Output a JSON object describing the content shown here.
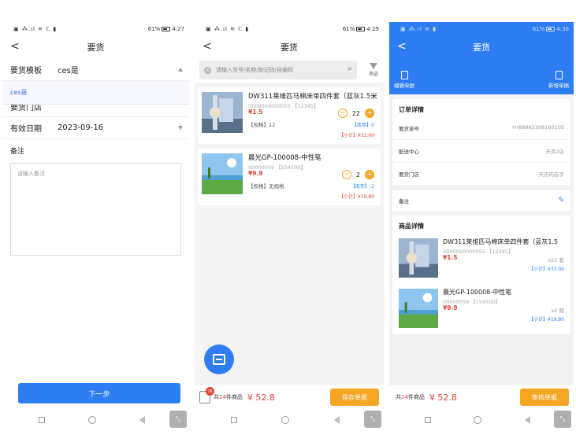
{
  "status": {
    "s1": {
      "icons": "▣ ⁂.ıl ≋ ℂ ▮",
      "battery": "61%",
      "time": "4:27"
    },
    "s2": {
      "icons": "▣ ⁂.ıl ≋ ℂ ▮",
      "battery": "61%",
      "time": "4:29"
    },
    "s3": {
      "icons": "▣ ⁂.ıl ≋ ▮",
      "battery": "61%",
      "time": "4:30"
    }
  },
  "screen1": {
    "back": "<",
    "title": "要货",
    "template_label": "要货模板",
    "template_value": "ces是",
    "dropdown_option": "ces是",
    "covered_label": "要货门店",
    "date_label": "有效日期",
    "date_value": "2023-09-16",
    "remark_label": "备注",
    "remark_placeholder": "请输入备注",
    "next_button": "下一步"
  },
  "screen2": {
    "back": "<",
    "title": "要货",
    "search_placeholder": "请输入货号/名称/助记码/自编码",
    "filter_label": "筛选",
    "items": [
      {
        "name": "DW311莱维匹马棉床单四件套（蓝灰1.5米",
        "code": "0000000000055 【12345】",
        "price": "¥1.5",
        "spec": "【规格】12",
        "qty": "22",
        "stock": "【库存】0",
        "subtotal": "【小计】¥33.00"
      },
      {
        "name": "晨光GP-100008-中性笔",
        "code": "00000059 【154500】",
        "price": "¥9.9",
        "spec": "【规格】无规格",
        "qty": "2",
        "stock": "【库存】-2",
        "subtotal": "【小计】¥19.80"
      }
    ],
    "cart_badge": "26",
    "count_prefix": "共",
    "count_value": "24",
    "count_suffix": "件商品",
    "total": "¥ 52.8",
    "save_button": "保存单据"
  },
  "screen3": {
    "back": "<",
    "title": "要货",
    "edit_doc": "编辑单据",
    "add_doc": "新增单据",
    "order_header": "订单详情",
    "order_no_label": "要货单号",
    "order_no": "YH88882308160105",
    "dist_label": "配送中心",
    "dist_value": "天添2店",
    "store_label": "要货门店",
    "store_value": "天店的店字",
    "remark_label": "备注",
    "goods_header": "商品详情",
    "items": [
      {
        "name": "DW311莱维匹马棉床单四件套（蓝灰1.5",
        "code": "0000000000055 【12345】",
        "price": "¥1.5",
        "qty": "x22 套",
        "subtotal": "【小计】¥33.00"
      },
      {
        "name": "晨光GP-100008-中性笔",
        "code": "00000059 【154500】",
        "price": "¥9.9",
        "qty": "x2 瓶",
        "subtotal": "【小计】¥19.80"
      }
    ],
    "count_prefix": "共",
    "count_value": "24",
    "count_suffix": "件商品",
    "total": "¥ 52.8",
    "audit_button": "审核单据"
  },
  "sysnav": {
    "expand_glyph": "⤡"
  }
}
